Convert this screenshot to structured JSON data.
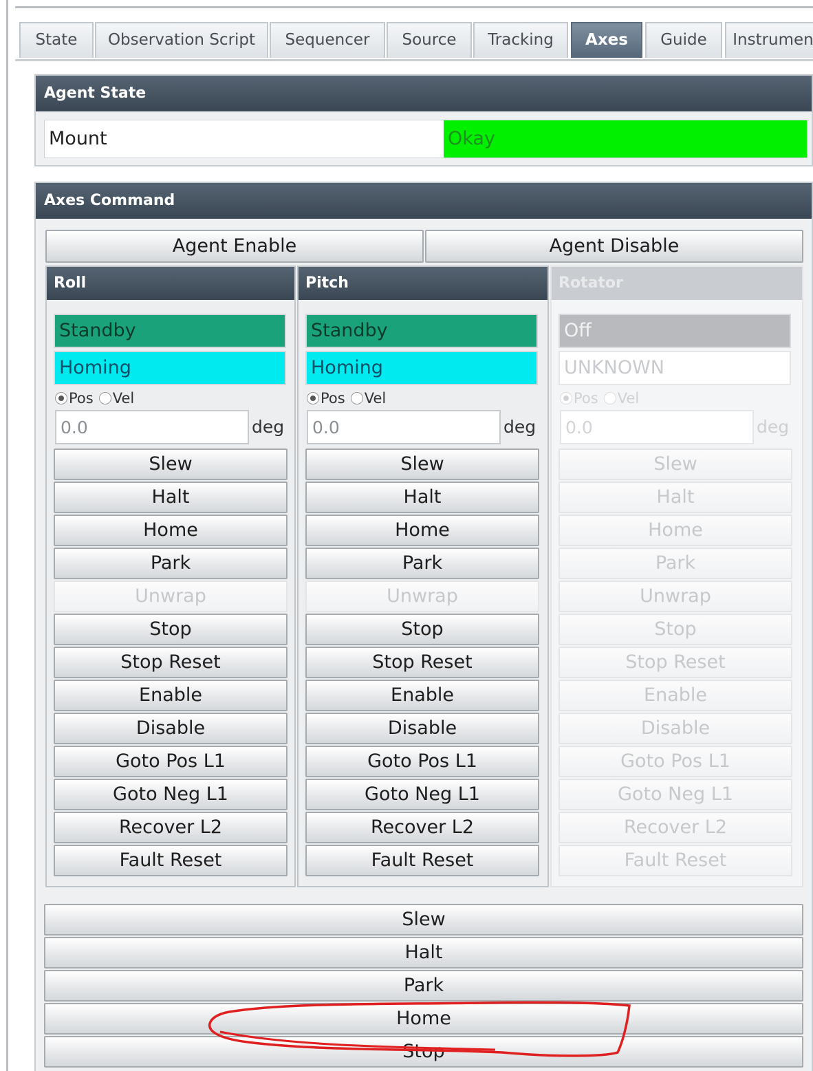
{
  "tabs": [
    "State",
    "Observation Script",
    "Sequencer",
    "Source",
    "Tracking",
    "Axes",
    "Guide",
    "Instrumen"
  ],
  "active_tab": "Axes",
  "agent_state": {
    "title": "Agent State",
    "name": "Mount",
    "status": "Okay",
    "status_color": "#00f000"
  },
  "axes_command": {
    "title": "Axes Command",
    "agent_enable": "Agent Enable",
    "agent_disable": "Agent Disable",
    "mode_pos": "Pos",
    "mode_vel": "Vel",
    "unit": "deg",
    "axes": [
      {
        "title": "Roll",
        "state": "Standby",
        "substate": "Homing",
        "value": "0.0",
        "enabled": true
      },
      {
        "title": "Pitch",
        "state": "Standby",
        "substate": "Homing",
        "value": "0.0",
        "enabled": true
      },
      {
        "title": "Rotator",
        "state": "Off",
        "substate": "UNKNOWN",
        "value": "0.0",
        "enabled": false
      }
    ],
    "axis_buttons": [
      "Slew",
      "Halt",
      "Home",
      "Park",
      "Unwrap",
      "Stop",
      "Stop Reset",
      "Enable",
      "Disable",
      "Goto Pos L1",
      "Goto Neg L1",
      "Recover L2",
      "Fault Reset"
    ],
    "disabled_axis_buttons": [
      "Unwrap"
    ],
    "bottom_buttons": [
      "Slew",
      "Halt",
      "Park",
      "Home",
      "Stop"
    ]
  },
  "colors": {
    "header": "#3f4b58",
    "standby": "#1aa37a",
    "homing": "#00eaf0",
    "annotation": "#e02020"
  }
}
